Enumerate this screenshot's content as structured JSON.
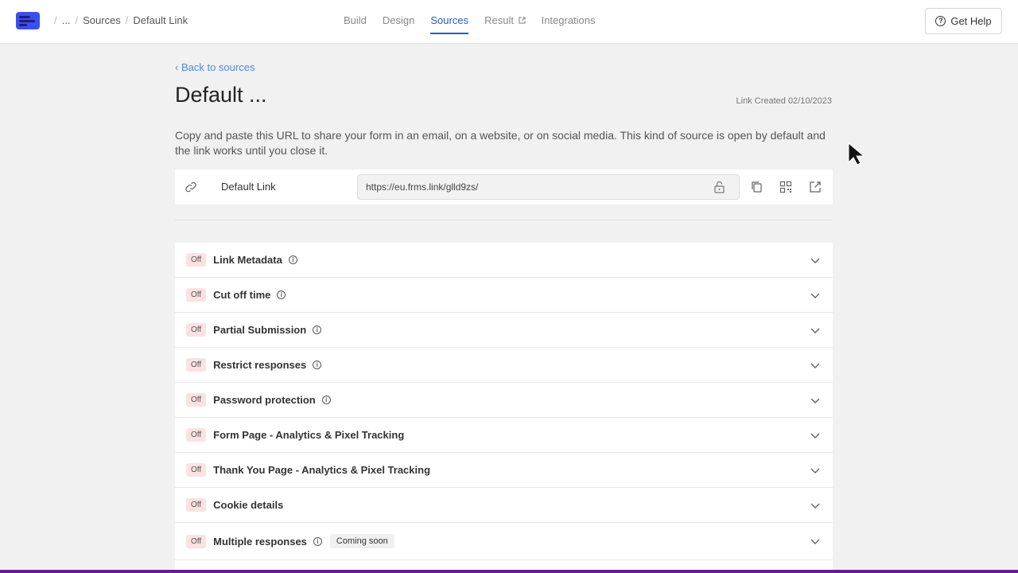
{
  "breadcrumb": {
    "ellipsis": "...",
    "sources": "Sources",
    "current": "Default Link"
  },
  "nav": {
    "build": "Build",
    "design": "Design",
    "sources": "Sources",
    "result": "Result",
    "integrations": "Integrations"
  },
  "help": {
    "label": "Get Help"
  },
  "back": {
    "label": "Back to sources"
  },
  "page": {
    "title": "Default ...",
    "created": "Link Created 02/10/2023",
    "description": "Copy and paste this URL to share your form in an email, on a website, or on social media. This kind of source is open by default and the link works until you close it."
  },
  "link": {
    "label": "Default Link",
    "url": "https://eu.frms.link/glld9zs/"
  },
  "settings": [
    {
      "status": "Off",
      "label": "Link Metadata"
    },
    {
      "status": "Off",
      "label": "Cut off time"
    },
    {
      "status": "Off",
      "label": "Partial Submission"
    },
    {
      "status": "Off",
      "label": "Restrict responses"
    },
    {
      "status": "Off",
      "label": "Password protection"
    },
    {
      "status": "Off",
      "label": "Form Page - Analytics & Pixel Tracking"
    },
    {
      "status": "Off",
      "label": "Thank You Page - Analytics & Pixel Tracking"
    },
    {
      "status": "Off",
      "label": "Cookie details"
    },
    {
      "status": "Off",
      "label": "Multiple responses",
      "tag": "Coming soon"
    }
  ],
  "colors": {
    "accent": "#1f5fbf",
    "link": "#4a8ae8",
    "off_badge": "#fbe2e2"
  }
}
